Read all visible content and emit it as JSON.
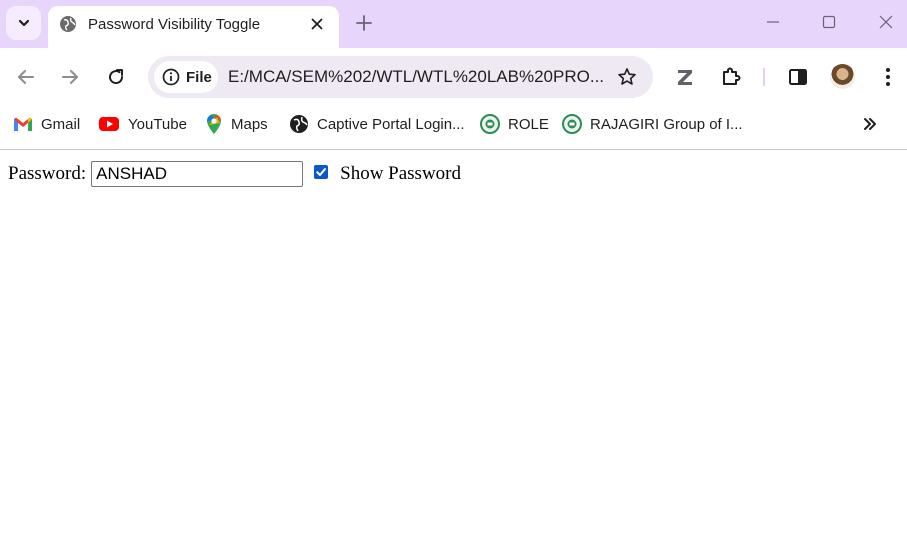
{
  "tab": {
    "title": "Password Visibility Toggle"
  },
  "omnibox": {
    "chip_label": "File",
    "url": "E:/MCA/SEM%202/WTL/WTL%20LAB%20PRO..."
  },
  "bookmarks": [
    {
      "label": "Gmail",
      "icon": "gmail-icon"
    },
    {
      "label": "YouTube",
      "icon": "youtube-icon"
    },
    {
      "label": "Maps",
      "icon": "maps-icon"
    },
    {
      "label": "Captive Portal Login...",
      "icon": "globe-icon"
    },
    {
      "label": "ROLE",
      "icon": "rajagiri-logo-icon"
    },
    {
      "label": "RAJAGIRI Group of I...",
      "icon": "rajagiri-logo-icon"
    }
  ],
  "page": {
    "password_label": "Password:",
    "password_value": "ANSHAD",
    "show_password_label": "Show Password",
    "show_password_checked": true
  },
  "colors": {
    "tabstrip": "#e8d5fb",
    "omnibox": "#efe9f3",
    "checkbox": "#0b57d0"
  }
}
